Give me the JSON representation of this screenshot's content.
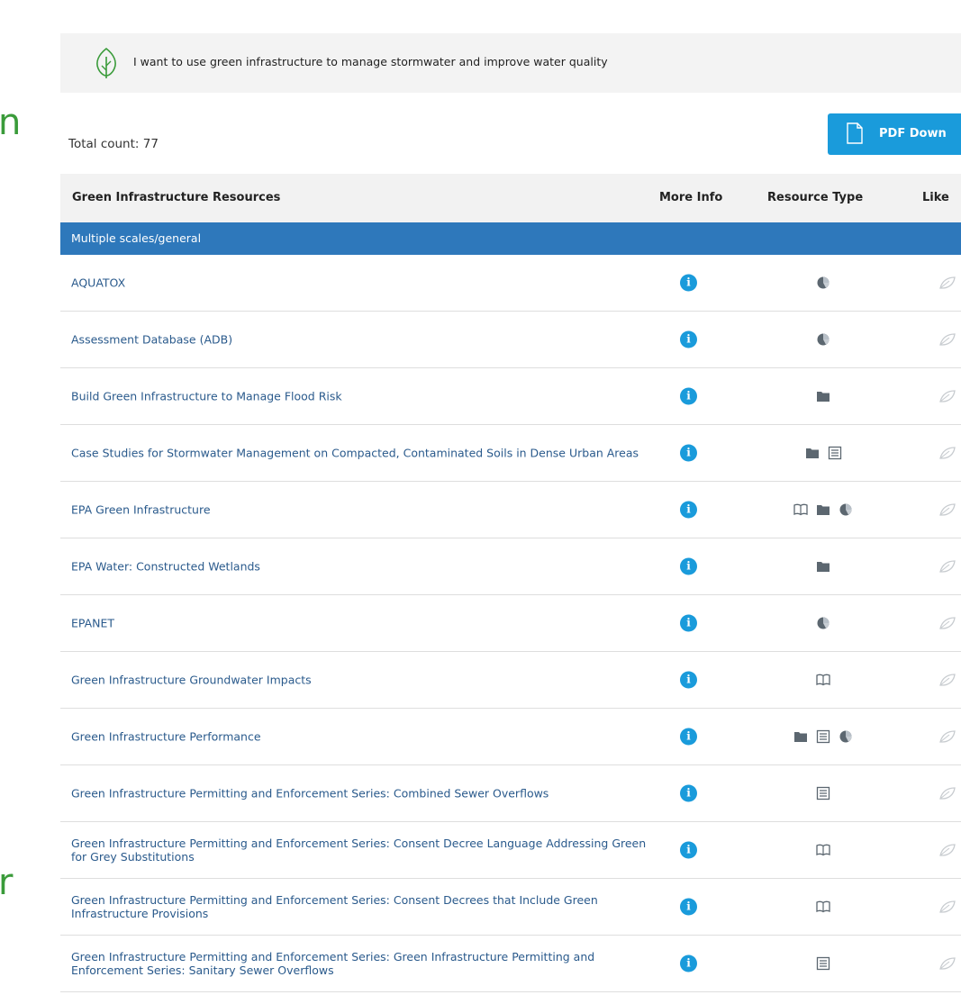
{
  "side_glyphs": [
    "n",
    "r"
  ],
  "banner": {
    "text": "I want to use green infrastructure to manage stormwater and improve water quality",
    "icon": "leaf-icon"
  },
  "total_count": "Total count: 77",
  "pdf_button": {
    "label": "PDF Down",
    "icon": "document-icon"
  },
  "colors": {
    "accent": "#1a9bdb",
    "group_bar": "#2e78bb",
    "link": "#2a5a8c",
    "leaf": "#3a9b3a",
    "icon_gray": "#5c6770"
  },
  "table": {
    "headers": {
      "name": "Green Infrastructure Resources",
      "info": "More Info",
      "type": "Resource Type",
      "like": "Like"
    },
    "group": "Multiple scales/general",
    "rows": [
      {
        "name": "AQUATOX",
        "types": [
          "model"
        ]
      },
      {
        "name": "Assessment Database (ADB)",
        "types": [
          "model"
        ]
      },
      {
        "name": "Build Green Infrastructure to Manage Flood Risk",
        "types": [
          "folder"
        ]
      },
      {
        "name": "Case Studies for Stormwater Management on Compacted, Contaminated Soils in Dense Urban Areas",
        "types": [
          "folder",
          "document"
        ]
      },
      {
        "name": "EPA Green Infrastructure",
        "types": [
          "book",
          "folder",
          "model"
        ]
      },
      {
        "name": "EPA Water: Constructed Wetlands",
        "types": [
          "folder"
        ]
      },
      {
        "name": "EPANET",
        "types": [
          "model"
        ]
      },
      {
        "name": "Green Infrastructure Groundwater Impacts",
        "types": [
          "book"
        ]
      },
      {
        "name": "Green Infrastructure Performance",
        "types": [
          "folder",
          "document",
          "model"
        ]
      },
      {
        "name": "Green Infrastructure Permitting and Enforcement Series: Combined Sewer Overflows",
        "types": [
          "document"
        ]
      },
      {
        "name": "Green Infrastructure Permitting and Enforcement Series: Consent Decree Language Addressing Green for Grey Substitutions",
        "types": [
          "book"
        ]
      },
      {
        "name": "Green Infrastructure Permitting and Enforcement Series: Consent Decrees that Include Green Infrastructure Provisions",
        "types": [
          "book"
        ]
      },
      {
        "name": "Green Infrastructure Permitting and Enforcement Series: Green Infrastructure Permitting and Enforcement Series: Sanitary Sewer Overflows",
        "types": [
          "document"
        ]
      }
    ]
  }
}
